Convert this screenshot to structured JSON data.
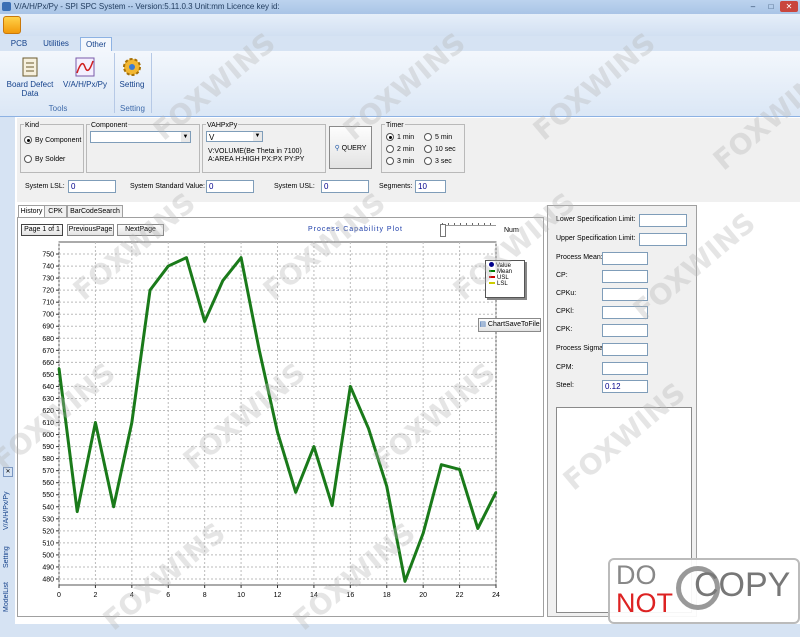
{
  "window": {
    "title": "V/A/H/Px/Py - SPI SPC System -- Version:5.11.0.3 Unit:mm Licence key id:"
  },
  "ribbon": {
    "tabs": [
      "PCB",
      "Utilities",
      "Other"
    ],
    "active_tab": "Other",
    "groups": [
      {
        "label": "Tools",
        "buttons": [
          {
            "label": "Board Defect Data",
            "icon": "board-defect-icon"
          },
          {
            "label": "V/A/H/Px/Py",
            "icon": "vahpxpy-icon"
          }
        ]
      },
      {
        "label": "Setting",
        "buttons": [
          {
            "label": "Setting",
            "icon": "gear-icon"
          }
        ]
      }
    ]
  },
  "filters": {
    "kind": {
      "title": "Kind",
      "options": [
        "By Component",
        "By Solder"
      ],
      "selected": "By Component"
    },
    "component": {
      "title": "Component",
      "value": ""
    },
    "vahpxpy": {
      "title": "VAHPxPy",
      "value": "V",
      "note1": "V:VOLUME(Be Theta in 7100)",
      "note2": "A:AREA H:HIGH PX:PX PY:PY"
    },
    "query_label": "QUERY",
    "timer": {
      "title": "Timer",
      "options": [
        "1 min",
        "5 min",
        "2 min",
        "10 sec",
        "3 min",
        "3 sec"
      ],
      "selected": "1 min"
    }
  },
  "limits": {
    "lsl_label": "System LSL:",
    "lsl_value": "0",
    "std_label": "System Standard Value:",
    "std_value": "0",
    "usl_label": "System USL:",
    "usl_value": "0",
    "segments_label": "Segments:",
    "segments_value": "10"
  },
  "subtabs": [
    "History",
    "CPK",
    "BarCodeSearch"
  ],
  "pager": {
    "page": "Page 1 of 1",
    "prev": "PreviousPage",
    "next": "NextPage"
  },
  "chart_header": {
    "title": "Process Capability Plot",
    "num_label": "Num"
  },
  "legend": [
    "Value",
    "Mean",
    "USL",
    "LSL"
  ],
  "save_button": "ChartSaveToFile",
  "stats": [
    {
      "label": "Lower Specification Limit:",
      "value": ""
    },
    {
      "label": "Upper Specification Limit:",
      "value": ""
    },
    {
      "label": "Process Mean:",
      "value": ""
    },
    {
      "label": "CP:",
      "value": ""
    },
    {
      "label": "CPKu:",
      "value": ""
    },
    {
      "label": "CPKl:",
      "value": ""
    },
    {
      "label": "CPK:",
      "value": ""
    },
    {
      "label": "Process Sigma:",
      "value": ""
    },
    {
      "label": "CPM:",
      "value": ""
    },
    {
      "label": "Steel:",
      "value": "0.12"
    }
  ],
  "side_panel": [
    "V/A/H/Px/Py",
    "Setting",
    "ModelList"
  ],
  "watermark": {
    "brand": "FOXWINS",
    "stamp_do": "DO",
    "stamp_not": "NOT",
    "stamp_copy": "COPY"
  },
  "colors": {
    "series": "#1a7a1a",
    "accent": "#15428b",
    "value_dot": "#00008b",
    "mean": "#008000",
    "usl": "#cc0000",
    "lsl": "#cccc00"
  },
  "chart_data": {
    "type": "line",
    "x": [
      0,
      1,
      2,
      3,
      4,
      5,
      6,
      7,
      8,
      9,
      10,
      11,
      12,
      13,
      14,
      15,
      16,
      17,
      18,
      19,
      20,
      21,
      22,
      23,
      24
    ],
    "values": [
      655,
      536,
      610,
      540,
      610,
      720,
      740,
      747,
      694,
      728,
      747,
      670,
      602,
      552,
      590,
      541,
      640,
      605,
      557,
      478,
      518,
      575,
      571,
      522,
      552
    ],
    "xlim": [
      0,
      24
    ],
    "ylim": [
      475,
      760
    ],
    "yticks": [
      480,
      490,
      500,
      510,
      520,
      530,
      540,
      550,
      560,
      570,
      580,
      590,
      600,
      610,
      620,
      630,
      640,
      650,
      660,
      670,
      680,
      690,
      700,
      710,
      720,
      730,
      740,
      750
    ],
    "xticks": [
      0,
      2,
      4,
      6,
      8,
      10,
      12,
      14,
      16,
      18,
      20,
      22,
      24
    ],
    "grid": true,
    "legend_position": "top-right"
  }
}
